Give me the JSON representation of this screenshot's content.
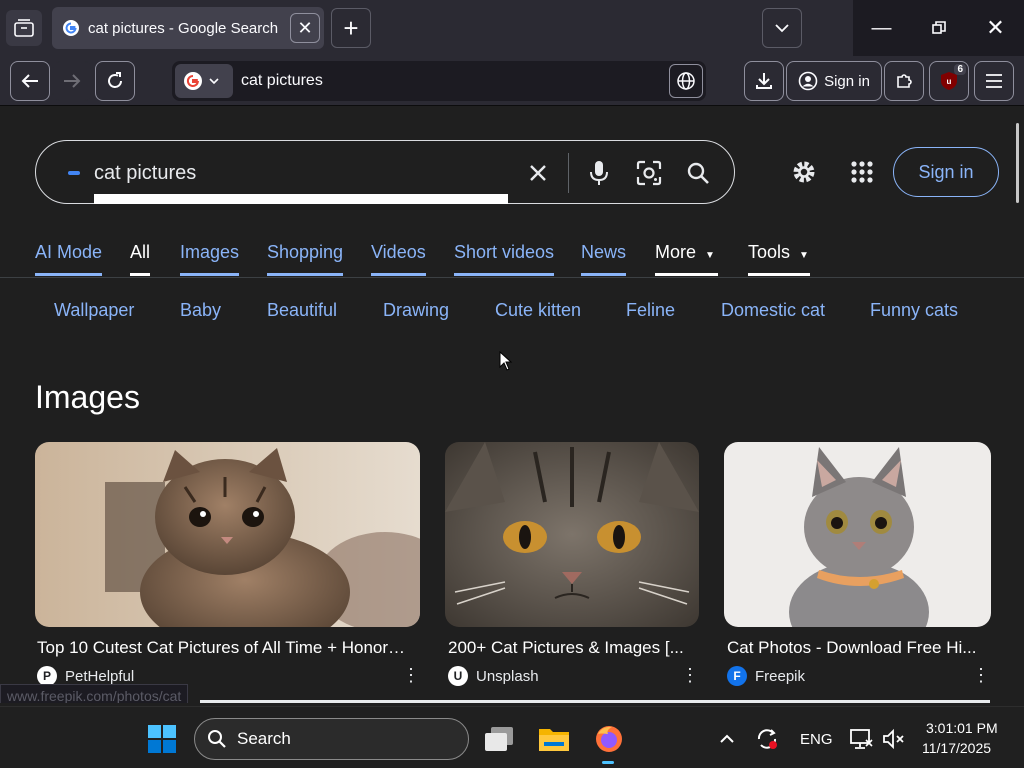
{
  "browser": {
    "tab_title": "cat pictures - Google Search",
    "url": "cat pictures",
    "signin_label": "Sign in",
    "extension_badge": "6"
  },
  "search": {
    "query": "cat pictures",
    "signin_label": "Sign in"
  },
  "nav_tabs": [
    {
      "label": "AI Mode"
    },
    {
      "label": "All"
    },
    {
      "label": "Images"
    },
    {
      "label": "Shopping"
    },
    {
      "label": "Videos"
    },
    {
      "label": "Short videos"
    },
    {
      "label": "News"
    },
    {
      "label": "More"
    },
    {
      "label": "Tools"
    }
  ],
  "chips": [
    "Wallpaper",
    "Baby",
    "Beautiful",
    "Drawing",
    "Cute kitten",
    "Feline",
    "Domestic cat",
    "Funny cats"
  ],
  "images_section": {
    "title": "Images",
    "results": [
      {
        "title": "Top 10 Cutest Cat Pictures of All Time + Honor…",
        "source": "PetHelpful",
        "logo": "P"
      },
      {
        "title": "200+ Cat Pictures & Images [...",
        "source": "Unsplash",
        "logo": "U"
      },
      {
        "title": "Cat Photos - Download Free Hi...",
        "source": "Freepik",
        "logo": "F"
      }
    ]
  },
  "status_url": "www.freepik.com/photos/cat",
  "taskbar": {
    "search_label": "Search",
    "language": "ENG",
    "time": "3:01:01 PM",
    "date": "11/17/2025"
  },
  "colors": {
    "link_blue": "#8ab4f8",
    "page_bg": "#1f1f1f",
    "chrome_bg": "#2b2a33"
  }
}
